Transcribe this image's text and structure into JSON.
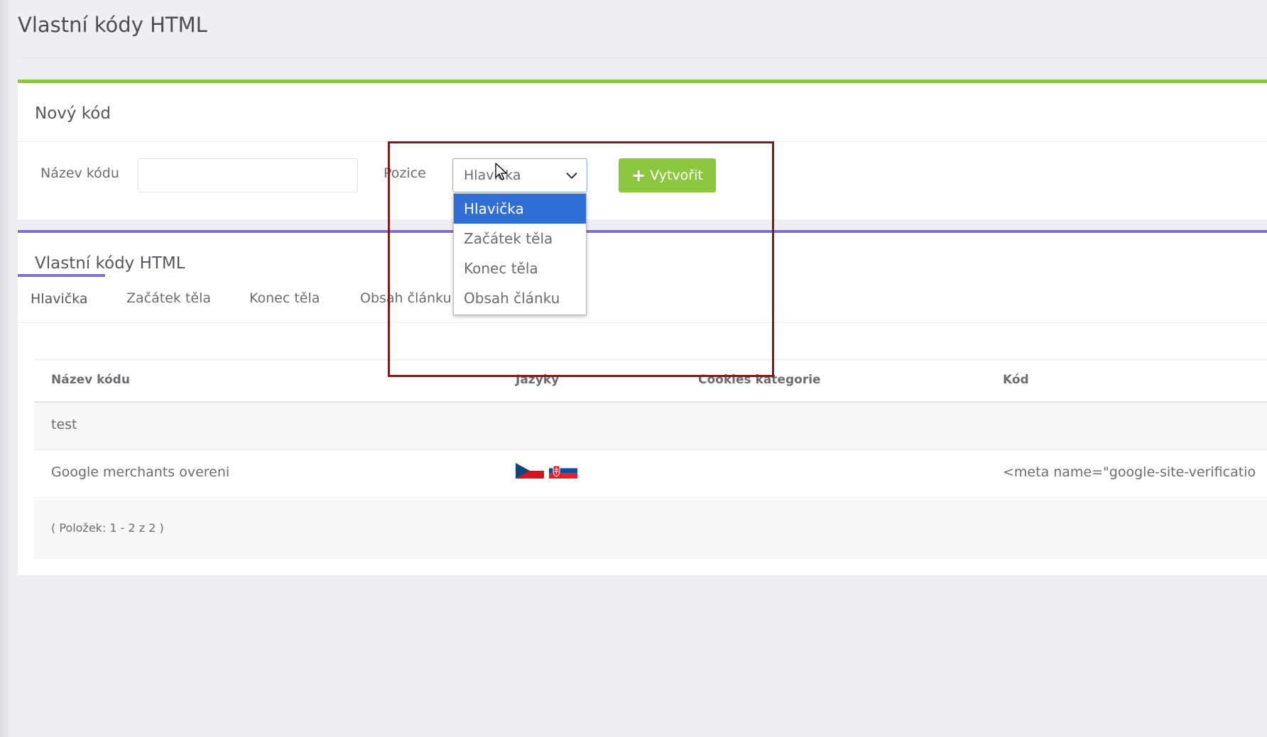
{
  "page": {
    "title": "Vlastní kódy HTML"
  },
  "new_code": {
    "title": "Nový kód",
    "name_label": "Název kódu",
    "name_value": "",
    "position_label": "Pozice",
    "position_value": "Hlavička",
    "create_label": "Vytvořit"
  },
  "dropdown": {
    "options": [
      "Hlavička",
      "Začátek těla",
      "Konec těla",
      "Obsah článku"
    ],
    "selected_index": 0
  },
  "list": {
    "title": "Vlastní kódy HTML",
    "tabs": [
      "Hlavička",
      "Začátek těla",
      "Konec těla",
      "Obsah článku"
    ],
    "active_tab": 0,
    "columns": [
      "Název kódu",
      "Jazyky",
      "Cookies kategorie",
      "Kód"
    ],
    "rows": [
      {
        "name": "test",
        "languages": [],
        "cookies": "",
        "code": ""
      },
      {
        "name": "Google merchants overeni",
        "languages": [
          "cz-flag-icon",
          "sk-flag-icon"
        ],
        "cookies": "",
        "code": "<meta name=\"google-site-verificatio"
      }
    ],
    "pager": "( Položek: 1 - 2 z 2 )"
  },
  "colors": {
    "accent_green": "#8dc63f",
    "accent_purple": "#7e6fc9",
    "selected_blue": "#2f6fd6",
    "highlight_red": "#7b1d1d"
  }
}
